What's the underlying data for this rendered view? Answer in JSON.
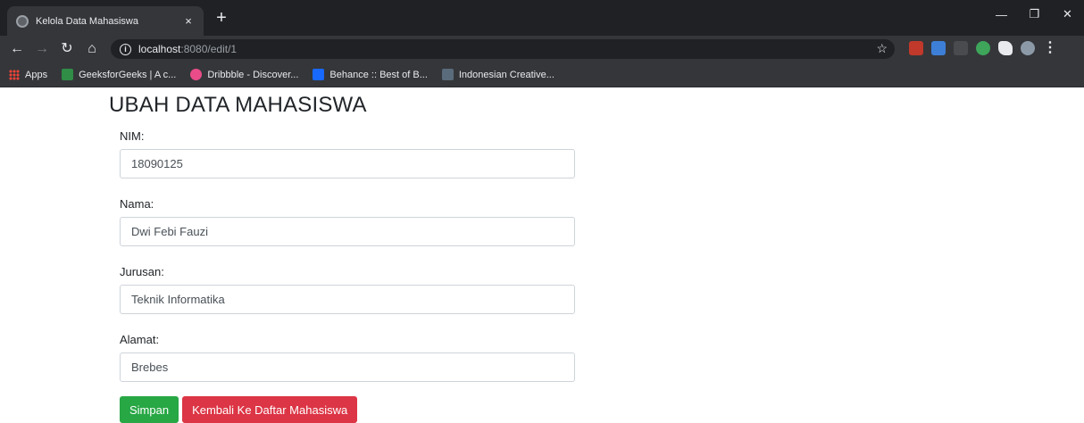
{
  "browser": {
    "tab_title": "Kelola Data Mahasiswa",
    "tab_close": "×",
    "new_tab": "+",
    "win_minimize": "—",
    "win_restore": "❐",
    "win_close": "✕",
    "url_host": "localhost",
    "url_path": ":8080/edit/1",
    "bookmarks": [
      {
        "label": "Apps",
        "icon_color": "#ea4335"
      },
      {
        "label": "GeeksforGeeks | A c...",
        "icon_color": "#2f8d46"
      },
      {
        "label": "Dribbble - Discover...",
        "icon_color": "#ea4c89"
      },
      {
        "label": "Behance :: Best of B...",
        "icon_color": "#1769ff"
      },
      {
        "label": "Indonesian Creative...",
        "icon_color": "#2b2b2b"
      }
    ]
  },
  "page": {
    "title": "UBAH DATA MAHASISWA",
    "fields": [
      {
        "label": "NIM:",
        "value": "18090125"
      },
      {
        "label": "Nama:",
        "value": "Dwi Febi Fauzi"
      },
      {
        "label": "Jurusan:",
        "value": "Teknik Informatika"
      },
      {
        "label": "Alamat:",
        "value": "Brebes"
      }
    ],
    "save_label": "Simpan",
    "back_label": "Kembali Ke Daftar Mahasiswa"
  },
  "colors": {
    "success": "#28a745",
    "danger": "#dc3545",
    "chrome_dark": "#202124",
    "chrome_toolbar": "#35363a"
  }
}
